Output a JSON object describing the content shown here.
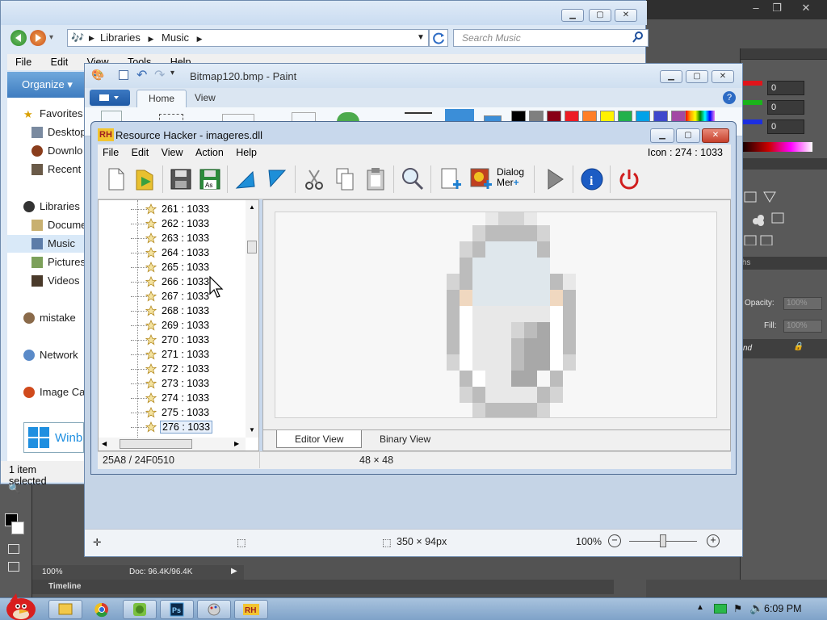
{
  "photoshop": {
    "rgb_values": [
      "0",
      "0",
      "0"
    ],
    "panel_tab": "ths",
    "opacity_label": "Opacity:",
    "opacity_value": "100%",
    "fill_label": "Fill:",
    "fill_value": "100%",
    "layer_name": "nd",
    "zoom": "100%",
    "doc_info": "Doc: 96.4K/96.4K",
    "timeline": "Timeline"
  },
  "explorer": {
    "breadcrumb": [
      "Libraries",
      "Music"
    ],
    "search_placeholder": "Search Music",
    "menu": [
      "File",
      "Edit",
      "View",
      "Tools",
      "Help"
    ],
    "organize": "Organize",
    "nav_items": [
      "Favorites",
      "Desktop",
      "Downlo",
      "Recent",
      "Libraries",
      "Docume",
      "Music",
      "Pictures",
      "Videos",
      "mistake",
      "Network",
      "Image Ca"
    ],
    "taskbar_button": "Winb",
    "status": "1 item selected"
  },
  "paint": {
    "title": "Bitmap120.bmp - Paint",
    "tabs": [
      "Home",
      "View"
    ],
    "canvas_size": "350 × 94px",
    "zoom": "100%",
    "colors": [
      "#000000",
      "#7f7f7f",
      "#880015",
      "#ed1c24",
      "#ff7f27",
      "#fff200",
      "#22b14c",
      "#00a2e8",
      "#3f48cc",
      "#a349a4"
    ]
  },
  "reshacker": {
    "title": "Resource Hacker - imageres.dll",
    "menu": [
      "File",
      "Edit",
      "View",
      "Action",
      "Help"
    ],
    "icon_info": "Icon : 274 : 1033",
    "dialog_merge_label": [
      "Dialog",
      "Mer"
    ],
    "tree_items": [
      "261 : 1033",
      "262 : 1033",
      "263 : 1033",
      "264 : 1033",
      "265 : 1033",
      "266 : 1033",
      "267 : 1033",
      "268 : 1033",
      "269 : 1033",
      "270 : 1033",
      "271 : 1033",
      "272 : 1033",
      "273 : 1033",
      "274 : 1033",
      "275 : 1033",
      "276 : 1033"
    ],
    "tabs": [
      "Editor View",
      "Binary View"
    ],
    "status_offset": "25A8 / 24F0510",
    "status_size": "48 × 48"
  },
  "taskbar": {
    "time": "6:09 PM"
  }
}
